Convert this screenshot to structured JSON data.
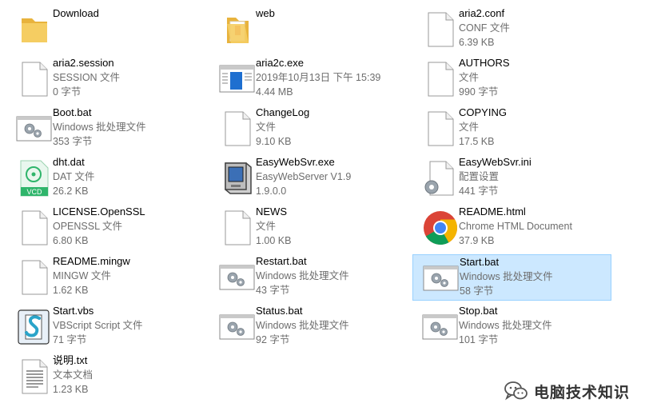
{
  "files": [
    {
      "name": "Download",
      "icon": "folder",
      "lines": []
    },
    {
      "name": "web",
      "icon": "folder-open",
      "lines": []
    },
    {
      "name": "aria2.conf",
      "icon": "blank-file",
      "lines": [
        "CONF 文件",
        "6.39 KB"
      ]
    },
    {
      "name": "aria2.session",
      "icon": "blank-file",
      "lines": [
        "SESSION 文件",
        "0 字节"
      ]
    },
    {
      "name": "aria2c.exe",
      "icon": "exe-window",
      "lines": [
        "2019年10月13日 下午 15:39",
        "4.44 MB"
      ]
    },
    {
      "name": "AUTHORS",
      "icon": "blank-file",
      "lines": [
        "文件",
        "990 字节"
      ]
    },
    {
      "name": "Boot.bat",
      "icon": "batch-gear",
      "lines": [
        "Windows 批处理文件",
        "353 字节"
      ]
    },
    {
      "name": "ChangeLog",
      "icon": "blank-file",
      "lines": [
        "文件",
        "9.10 KB"
      ]
    },
    {
      "name": "COPYING",
      "icon": "blank-file",
      "lines": [
        "文件",
        "17.5 KB"
      ]
    },
    {
      "name": "dht.dat",
      "icon": "vcd",
      "lines": [
        "DAT 文件",
        "26.2 KB"
      ]
    },
    {
      "name": "EasyWebSvr.exe",
      "icon": "server-computer",
      "lines": [
        "EasyWebServer V1.9",
        "1.9.0.0"
      ]
    },
    {
      "name": "EasyWebSvr.ini",
      "icon": "settings-file",
      "lines": [
        "配置设置",
        "441 字节"
      ]
    },
    {
      "name": "LICENSE.OpenSSL",
      "icon": "blank-file",
      "lines": [
        "OPENSSL 文件",
        "6.80 KB"
      ]
    },
    {
      "name": "NEWS",
      "icon": "blank-file",
      "lines": [
        "文件",
        "1.00 KB"
      ]
    },
    {
      "name": "README.html",
      "icon": "chrome",
      "lines": [
        "Chrome HTML Document",
        "37.9 KB"
      ]
    },
    {
      "name": "README.mingw",
      "icon": "blank-file",
      "lines": [
        "MINGW 文件",
        "1.62 KB"
      ]
    },
    {
      "name": "Restart.bat",
      "icon": "batch-gear",
      "lines": [
        "Windows 批处理文件",
        "43 字节"
      ]
    },
    {
      "name": "Start.bat",
      "icon": "batch-gear",
      "selected": true,
      "lines": [
        "Windows 批处理文件",
        "58 字节"
      ]
    },
    {
      "name": "Start.vbs",
      "icon": "vbscript",
      "lines": [
        "VBScript Script 文件",
        "71 字节"
      ]
    },
    {
      "name": "Status.bat",
      "icon": "batch-gear",
      "lines": [
        "Windows 批处理文件",
        "92 字节"
      ]
    },
    {
      "name": "Stop.bat",
      "icon": "batch-gear",
      "lines": [
        "Windows 批处理文件",
        "101 字节"
      ]
    },
    {
      "name": "说明.txt",
      "icon": "text-file",
      "lines": [
        "文本文档",
        "1.23 KB"
      ]
    }
  ],
  "watermark": {
    "text": "电脑技术知识",
    "icon": "wechat-icon"
  },
  "colors": {
    "selection_bg": "#cce8ff",
    "selection_border": "#99d1ff",
    "secondary_text": "#6d6d6d",
    "folder": "#f2c14e"
  }
}
